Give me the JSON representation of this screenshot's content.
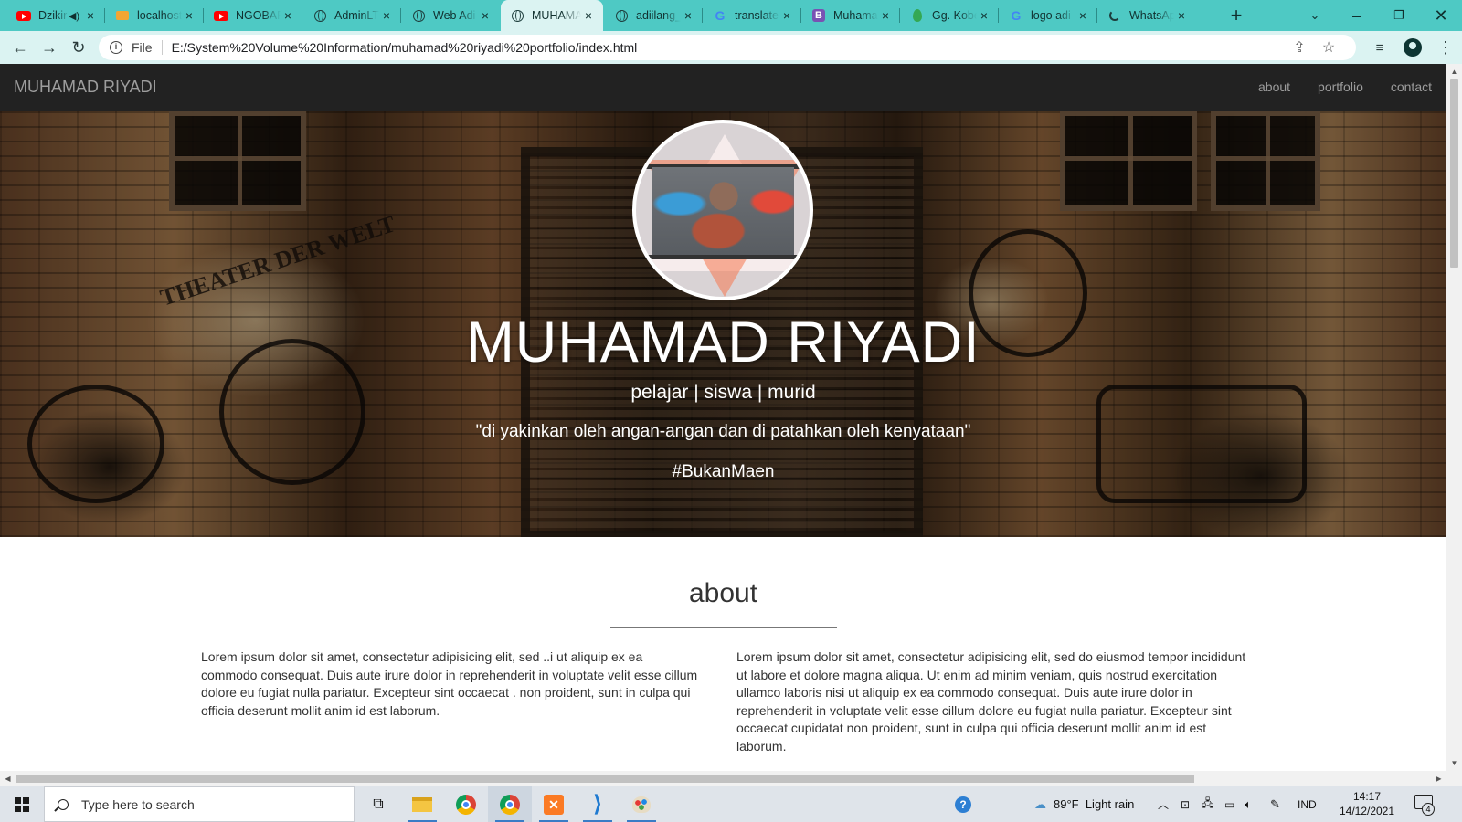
{
  "browser": {
    "tabs": [
      {
        "title": "Dzikir",
        "icon": "youtube-icon",
        "audio": true,
        "active": false
      },
      {
        "title": "localhost",
        "icon": "xampp-icon",
        "active": false
      },
      {
        "title": "NGOBAR",
        "icon": "youtube-icon",
        "active": false
      },
      {
        "title": "AdminLTE",
        "icon": "globe-icon",
        "active": false
      },
      {
        "title": "Web Adi",
        "icon": "globe-icon",
        "active": false
      },
      {
        "title": "MUHAMAD",
        "icon": "globe-icon",
        "active": true
      },
      {
        "title": "adiilang_",
        "icon": "globe-icon",
        "active": false
      },
      {
        "title": "translate",
        "icon": "google-icon",
        "active": false
      },
      {
        "title": "Muhamad",
        "icon": "bootstrap-icon",
        "active": false
      },
      {
        "title": "Gg. Kobe",
        "icon": "maps-pin-icon",
        "active": false
      },
      {
        "title": "logo adi",
        "icon": "google-icon",
        "active": false
      },
      {
        "title": "WhatsApp",
        "icon": "loading-icon",
        "active": false
      }
    ],
    "new_tab_label": "+",
    "scheme_label": "File",
    "url": "E:/System%20Volume%20Information/muhamad%20riyadi%20portfolio/index.html"
  },
  "site": {
    "brand": "MUHAMAD RIYADI",
    "nav": [
      "about",
      "portfolio",
      "contact"
    ],
    "hero": {
      "title": "MUHAMAD RIYADI",
      "subtitle": "pelajar | siswa | murid",
      "quote": "\"di yakinkan oleh angan-angan dan di patahkan oleh kenyataan\"",
      "hashtag": "#BukanMaen",
      "graffiti_text": "THEATER DER WELT"
    },
    "about": {
      "heading": "about",
      "left": "Lorem ipsum dolor sit amet, consectetur adipisicing elit, sed ..i ut aliquip ex ea commodo consequat. Duis aute irure dolor in reprehenderit in voluptate velit esse cillum dolore eu fugiat nulla pariatur. Excepteur sint occaecat . non proident, sunt in culpa qui officia deserunt mollit anim id est laborum.",
      "right": "Lorem ipsum dolor sit amet, consectetur adipisicing elit, sed do eiusmod tempor incididunt ut labore et dolore magna aliqua. Ut enim ad minim veniam, quis nostrud exercitation ullamco laboris nisi ut aliquip ex ea commodo consequat. Duis aute irure dolor in reprehenderit in voluptate velit esse cillum dolore eu fugiat nulla pariatur. Excepteur sint occaecat cupidatat non proident, sunt in culpa qui officia deserunt mollit anim id est laborum."
    }
  },
  "taskbar": {
    "search_placeholder": "Type here to search",
    "weather": "89°F  Light rain",
    "language": "IND",
    "time": "14:17",
    "date": "14/12/2021",
    "notification_count": "4"
  },
  "colors": {
    "tabstrip": "#4ec9c4",
    "toolbar": "#dbf3f2",
    "site_nav": "#222222"
  }
}
